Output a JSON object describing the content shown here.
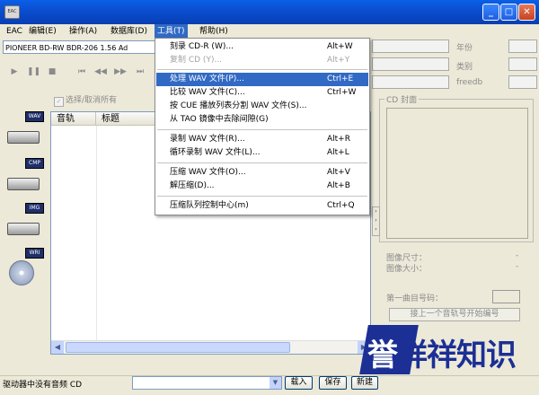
{
  "window": {
    "app_icon_text": "EAC",
    "caption_buttons": [
      "minimize-icon",
      "maximize-icon",
      "close-icon"
    ]
  },
  "menubar": {
    "items": [
      {
        "label": "EAC"
      },
      {
        "label": "编辑(E)"
      },
      {
        "label": "操作(A)"
      },
      {
        "label": "数据库(D)"
      },
      {
        "label": "工具(T)"
      },
      {
        "label": "帮助(H)"
      }
    ],
    "active_index": 4
  },
  "toolbar": {
    "drive_value": "PIONEER BD-RW   BDR-206 1.56   Ad",
    "transport_icons": [
      "play-icon",
      "pause-icon",
      "stop-icon",
      "first-track-icon",
      "rewind-icon",
      "forward-icon",
      "last-track-icon"
    ],
    "select_all_label": "选择/取消所有"
  },
  "left_icons": [
    {
      "tag": "WAV"
    },
    {
      "tag": "CMP"
    },
    {
      "tag": "IMG"
    },
    {
      "tag": "WRI"
    }
  ],
  "tracklist": {
    "columns": [
      "音轨",
      "标题"
    ]
  },
  "right_panel": {
    "labels": {
      "year": "年份",
      "genre": "类别",
      "freedb": "freedb"
    },
    "cover_title": "CD 封面",
    "image_size_label": "图像尺寸：",
    "image_size_value": "-",
    "image_filesize_label": "图像大小：",
    "image_filesize_value": "-",
    "first_track_label": "第一曲目号码：",
    "prev_track_button": "接上一个音轨号开始编号"
  },
  "tools_menu": {
    "items": [
      {
        "label": "刻录 CD-R (W)...",
        "shortcut": "Alt+W",
        "state": "normal"
      },
      {
        "label": "复制 CD (Y)...",
        "shortcut": "Alt+Y",
        "state": "disabled"
      },
      {
        "label": "处理 WAV 文件(P)...",
        "shortcut": "Ctrl+E",
        "state": "highlighted"
      },
      {
        "label": "比较 WAV 文件(C)...",
        "shortcut": "Ctrl+W",
        "state": "normal"
      },
      {
        "label": "按 CUE 播放列表分割 WAV 文件(S)...",
        "shortcut": "",
        "state": "normal"
      },
      {
        "label": "从 TAO 镜像中去除间隙(G)",
        "shortcut": "",
        "state": "normal"
      },
      {
        "label": "录制 WAV 文件(R)...",
        "shortcut": "Alt+R",
        "state": "normal"
      },
      {
        "label": "循环录制 WAV 文件(L)...",
        "shortcut": "Alt+L",
        "state": "normal"
      },
      {
        "label": "压缩 WAV 文件(O)...",
        "shortcut": "Alt+V",
        "state": "normal"
      },
      {
        "label": "解压缩(D)...",
        "shortcut": "Alt+B",
        "state": "normal"
      },
      {
        "label": "压缩队列控制中心(m)",
        "shortcut": "Ctrl+Q",
        "state": "normal"
      }
    ]
  },
  "statusbar": {
    "text": "驱动器中没有音频 CD",
    "load_button": "载入",
    "save_button": "保存",
    "new_button": "新建"
  },
  "watermark": {
    "text": "誉祥祥知识"
  }
}
